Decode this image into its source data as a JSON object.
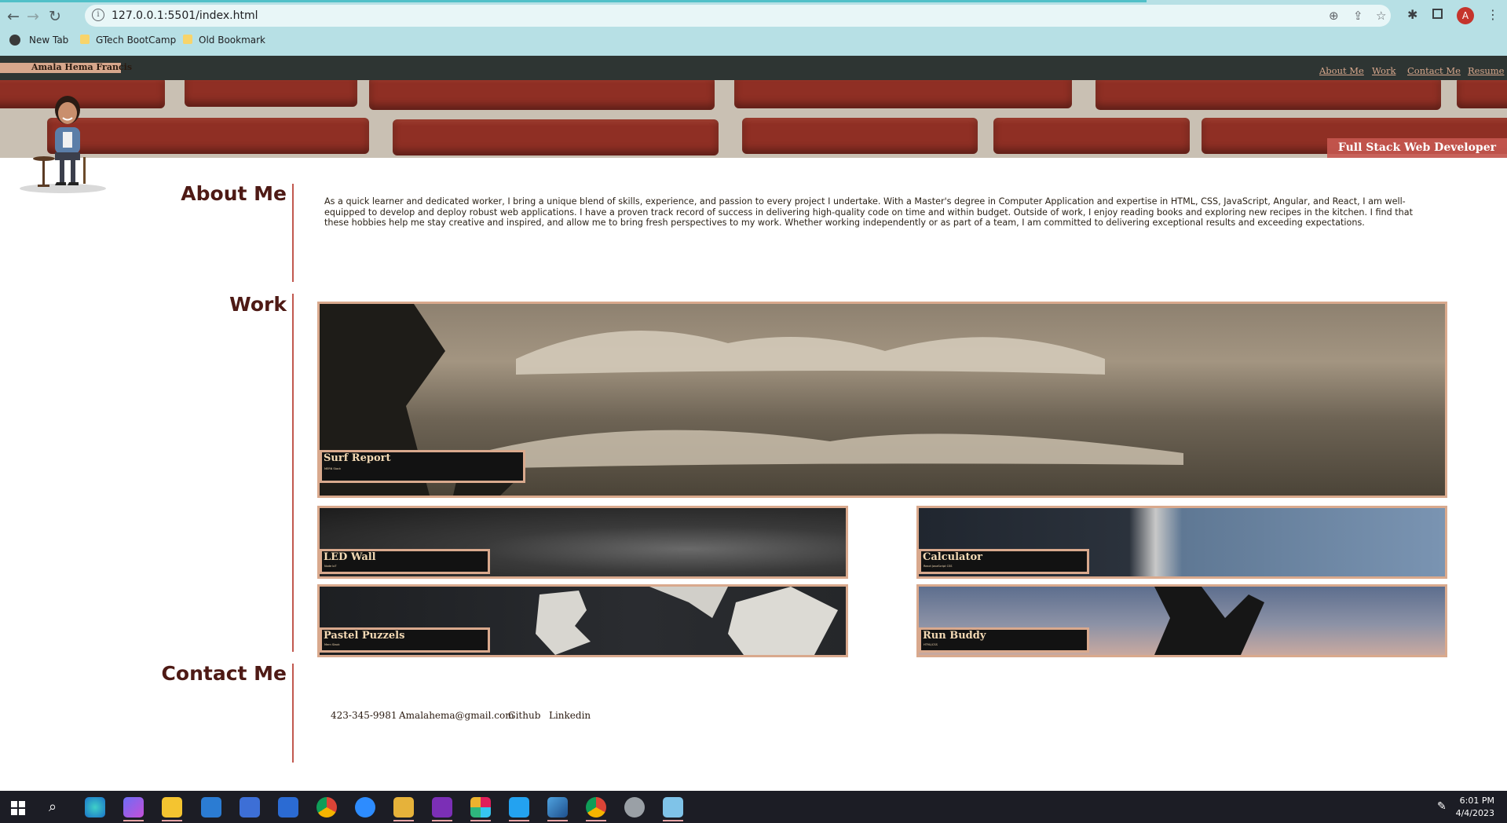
{
  "browser": {
    "url": "127.0.0.1:5501/index.html",
    "profile_initial": "A",
    "bookmarks": [
      "New Tab",
      "GTech BootCamp",
      "Old Bookmark"
    ]
  },
  "site": {
    "name": "Amala Hema Francis",
    "nav": [
      "About Me",
      "Work",
      "Contact Me",
      "Resume"
    ],
    "tagline": "Full Stack Web Developer"
  },
  "about": {
    "heading": "About Me",
    "text": "As a quick learner and dedicated worker, I bring a unique blend of skills, experience, and passion to every project I undertake. With a Master's degree in Computer Application and expertise in HTML, CSS, JavaScript, Angular, and React, I am well-equipped to develop and deploy robust web applications. I have a proven track record of success in delivering high-quality code on time and within budget. Outside of work, I enjoy reading books and exploring new recipes in the kitchen. I find that these hobbies help me stay creative and inspired, and allow me to bring fresh perspectives to my work. Whether working independently or as part of a team, I am committed to delivering exceptional results and exceeding expectations."
  },
  "work": {
    "heading": "Work",
    "projects": [
      {
        "title": "Surf Report",
        "sub": "MERN Stack"
      },
      {
        "title": "LED Wall",
        "sub": "Node IoT"
      },
      {
        "title": "Calculator",
        "sub": "React JavaScript CSS"
      },
      {
        "title": "Pastel Puzzels",
        "sub": "Mern Stack"
      },
      {
        "title": "Run Buddy",
        "sub": "HTML/CSS"
      }
    ]
  },
  "contact": {
    "heading": "Contact Me",
    "phone": "423-345-9981",
    "email": "Amalahema@gmail.com",
    "github": "Github",
    "linkedin": "Linkedin"
  },
  "taskbar": {
    "time": "6:01 PM",
    "date": "4/4/2023",
    "apps": [
      "windows-start",
      "search",
      "edge",
      "copilot",
      "file-explorer",
      "mail",
      "store",
      "calendar",
      "chrome",
      "zoom",
      "git",
      "onenote",
      "slack",
      "vscode",
      "photos",
      "chrome-profile",
      "settings",
      "notepad"
    ]
  },
  "colors": {
    "header": "#2e3533",
    "accent": "#d7a78c",
    "heading": "#4e1a15",
    "divider": "#c2584f"
  }
}
